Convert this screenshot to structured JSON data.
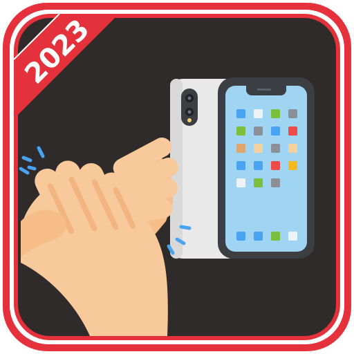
{
  "app_icon": {
    "badge_text": "2023",
    "colors": {
      "frame_red": "#e5313b",
      "frame_white": "#ffffff",
      "background": "#2f2b2b",
      "hand": "#f8c99a",
      "hand_shade": "#f0b07c",
      "phone_body": "#e8e8e8",
      "phone_frame": "#3b3f44",
      "screen": "#9fd5f2",
      "clap_marks": "#4aa3f0"
    },
    "icons": {
      "hands": "clapping-hands-icon",
      "phone": "smartphone-icon"
    }
  }
}
